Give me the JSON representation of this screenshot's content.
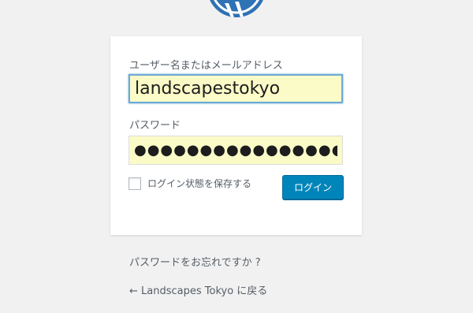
{
  "login_form": {
    "username_label": "ユーザー名またはメールアドレス",
    "username_value": "landscapestokyo",
    "password_label": "パスワード",
    "password_value": "●●●●●●●●●●●●●●●●●",
    "remember_label": "ログイン状態を保存する",
    "remember_checked": false,
    "submit_label": "ログイン"
  },
  "links": {
    "lost_password": "パスワードをお忘れですか ?",
    "back_to_site": "← Landscapes Tokyo に戻る"
  },
  "colors": {
    "background": "#f1f1f1",
    "logo_blue": "#2f72b5",
    "button_blue": "#0085ba",
    "autofill_yellow": "#fbfbc8"
  },
  "icons": {
    "logo": "wordpress-logo-icon"
  }
}
